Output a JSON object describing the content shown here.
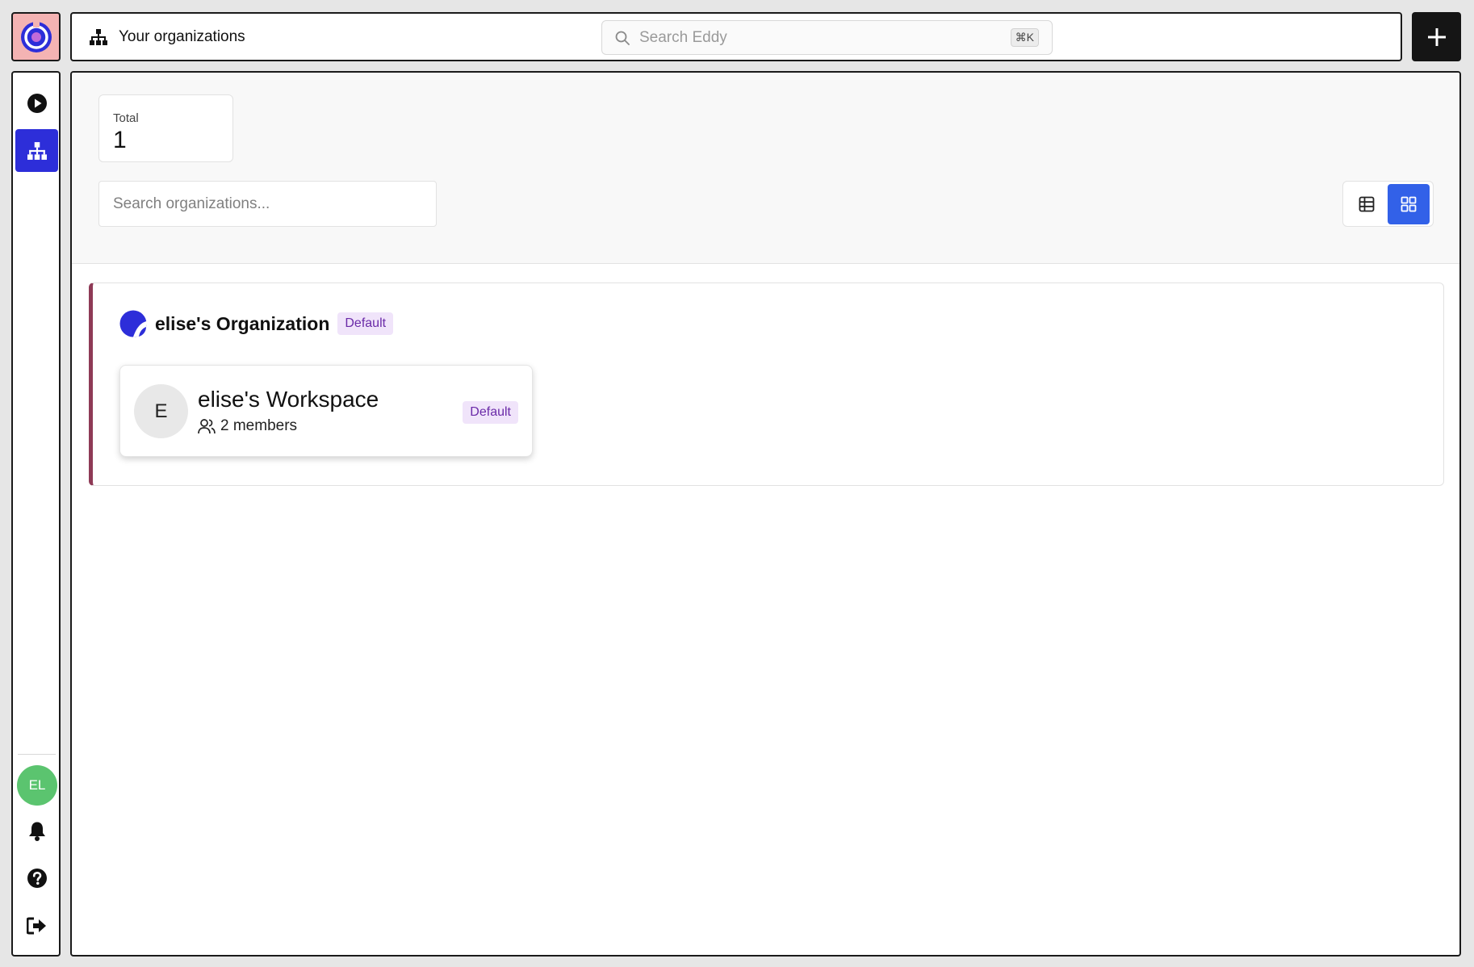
{
  "header": {
    "title": "Your organizations",
    "search_placeholder": "Search Eddy",
    "search_shortcut": "⌘K"
  },
  "sidebar": {
    "items": [
      {
        "name": "play",
        "icon": "play-circle-icon",
        "active": false
      },
      {
        "name": "organizations",
        "icon": "sitemap-icon",
        "active": true
      }
    ],
    "user_initials": "EL",
    "bottom_icons": [
      "bell-icon",
      "help-icon",
      "logout-icon"
    ]
  },
  "stats": {
    "total_label": "Total",
    "total_value": "1"
  },
  "filters": {
    "search_placeholder": "Search organizations...",
    "view_mode": "grid"
  },
  "organization": {
    "name": "elise's Organization",
    "badge": "Default",
    "workspace": {
      "initial": "E",
      "name": "elise's Workspace",
      "members": "2 members",
      "badge": "Default"
    }
  },
  "colors": {
    "accent": "#2d2ed9",
    "toggle_active": "#3261e8",
    "org_border": "#8e3a56",
    "avatar_green": "#5bc46f",
    "badge_bg": "#f0e4fa",
    "badge_text": "#6a2aa8"
  }
}
